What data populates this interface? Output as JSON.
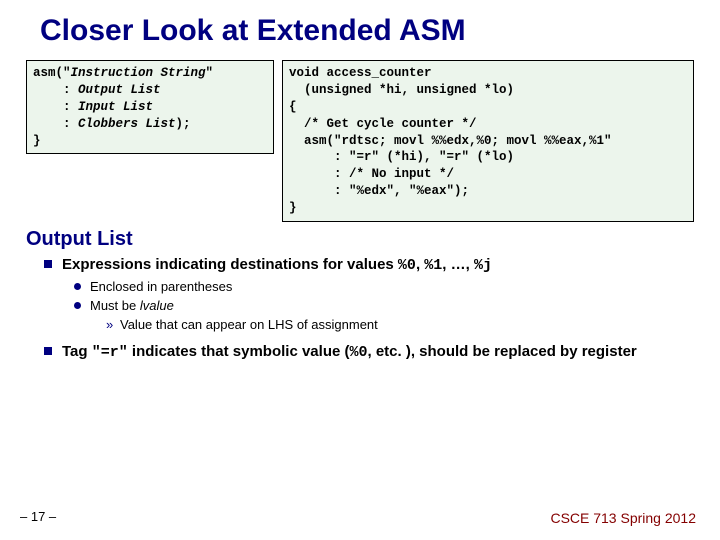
{
  "title": "Closer Look at Extended ASM",
  "syntax": {
    "l1": "asm(\"",
    "l1_i": "Instruction String",
    "l1_end": "\"",
    "l2": "    : ",
    "l2_i": "Output List",
    "l3": "    : ",
    "l3_i": "Input List",
    "l4": "    : ",
    "l4_i": "Clobbers List",
    "l4_end": ");",
    "l5": "}"
  },
  "example": {
    "l1": "void access_counter",
    "l2": "  (unsigned *hi, unsigned *lo)",
    "l3": "{",
    "l4": "  /* Get cycle counter */",
    "l5": "  asm(\"rdtsc; movl %%edx,%0; movl %%eax,%1\"",
    "l6": "      : \"=r\" (*hi), \"=r\" (*lo)",
    "l7": "      : /* No input */",
    "l8": "      : \"%edx\", \"%eax\");",
    "l9": "}"
  },
  "section": "Output List",
  "b1_pre": "Expressions indicating destinations for values ",
  "b1_code": "%0",
  "b1_mid1": ", ",
  "b1_code2": "%1",
  "b1_mid2": ", …, ",
  "b1_code3": "%j",
  "b1s1": "Enclosed in parentheses",
  "b1s2_pre": "Must be ",
  "b1s2_em": "lvalue",
  "b1s2s1": "Value that can appear on LHS of assignment",
  "b2_pre": "Tag ",
  "b2_code": "\"=r\"",
  "b2_mid": " indicates that symbolic value (",
  "b2_code2": "%0",
  "b2_end": ", etc. ), should be replaced by register",
  "footer_left": "– 17 –",
  "footer_right": "CSCE 713 Spring 2012"
}
